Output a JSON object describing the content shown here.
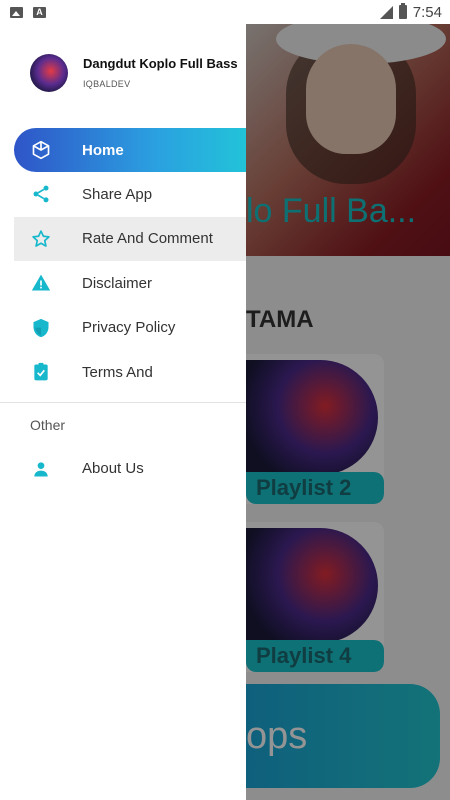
{
  "status_bar": {
    "time": "7:54",
    "left_icons": [
      "image-icon",
      "a-icon"
    ],
    "right_icons": [
      "signal-icon",
      "battery-icon"
    ]
  },
  "drawer": {
    "header": {
      "app_title": "Dangdut Koplo Full Bass",
      "developer": "IQBALDEV"
    },
    "items": [
      {
        "label": "Home",
        "icon": "cube-icon",
        "active": true
      },
      {
        "label": "Share App",
        "icon": "share-icon"
      },
      {
        "label": "Rate And Comment",
        "icon": "star-icon"
      },
      {
        "label": "Disclaimer",
        "icon": "warning-icon"
      },
      {
        "label": "Privacy Policy",
        "icon": "shield-icon"
      },
      {
        "label": "Terms And",
        "icon": "clipboard-check-icon"
      }
    ],
    "other_section": {
      "label": "Other",
      "items": [
        {
          "label": "About Us",
          "icon": "person-icon"
        }
      ]
    }
  },
  "background": {
    "banner_text": "lo Full Ba...",
    "section_title": "TAMA",
    "cards": [
      {
        "label": "Playlist 2"
      },
      {
        "label": "Playlist 4"
      }
    ],
    "button_text": "ops"
  },
  "colors": {
    "accent": "#19c3cc",
    "active_gradient_start": "#2f55c8",
    "active_gradient_end": "#22c3d9",
    "icon": "#17b7cc"
  }
}
